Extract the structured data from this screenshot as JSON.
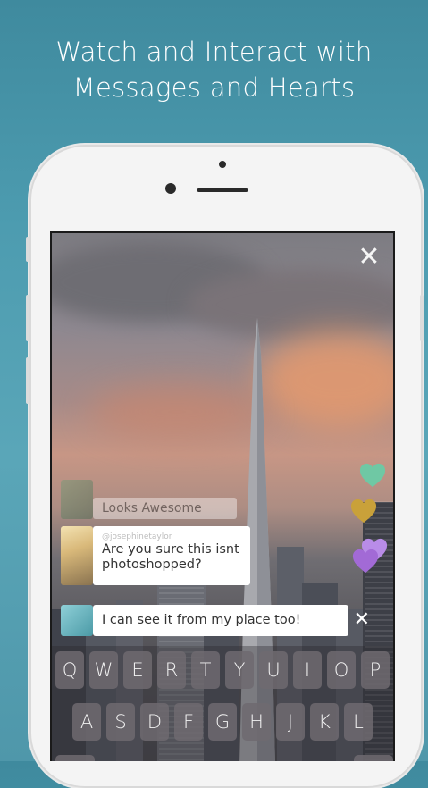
{
  "headline": {
    "line1": "Watch and Interact with",
    "line2": "Messages and Hearts"
  },
  "screen": {
    "close_icon": "close-icon",
    "hearts": [
      {
        "color": "#6fc8a4"
      },
      {
        "color": "#c9a13a"
      },
      {
        "color": "#b98ce8"
      },
      {
        "color": "#a26ad6"
      }
    ],
    "faded_comment": {
      "text": "Looks Awesome"
    },
    "comment": {
      "username": "@josephinetaylor",
      "line1": "Are you sure this isnt",
      "line2": "photoshopped?"
    },
    "composer": {
      "value": "I can see it from my place too!",
      "close_glyph": "✕"
    }
  },
  "keyboard": {
    "row1": [
      "Q",
      "W",
      "E",
      "R",
      "T",
      "Y",
      "U",
      "I",
      "O",
      "P"
    ],
    "row2": [
      "A",
      "S",
      "D",
      "F",
      "G",
      "H",
      "J",
      "K",
      "L"
    ]
  }
}
